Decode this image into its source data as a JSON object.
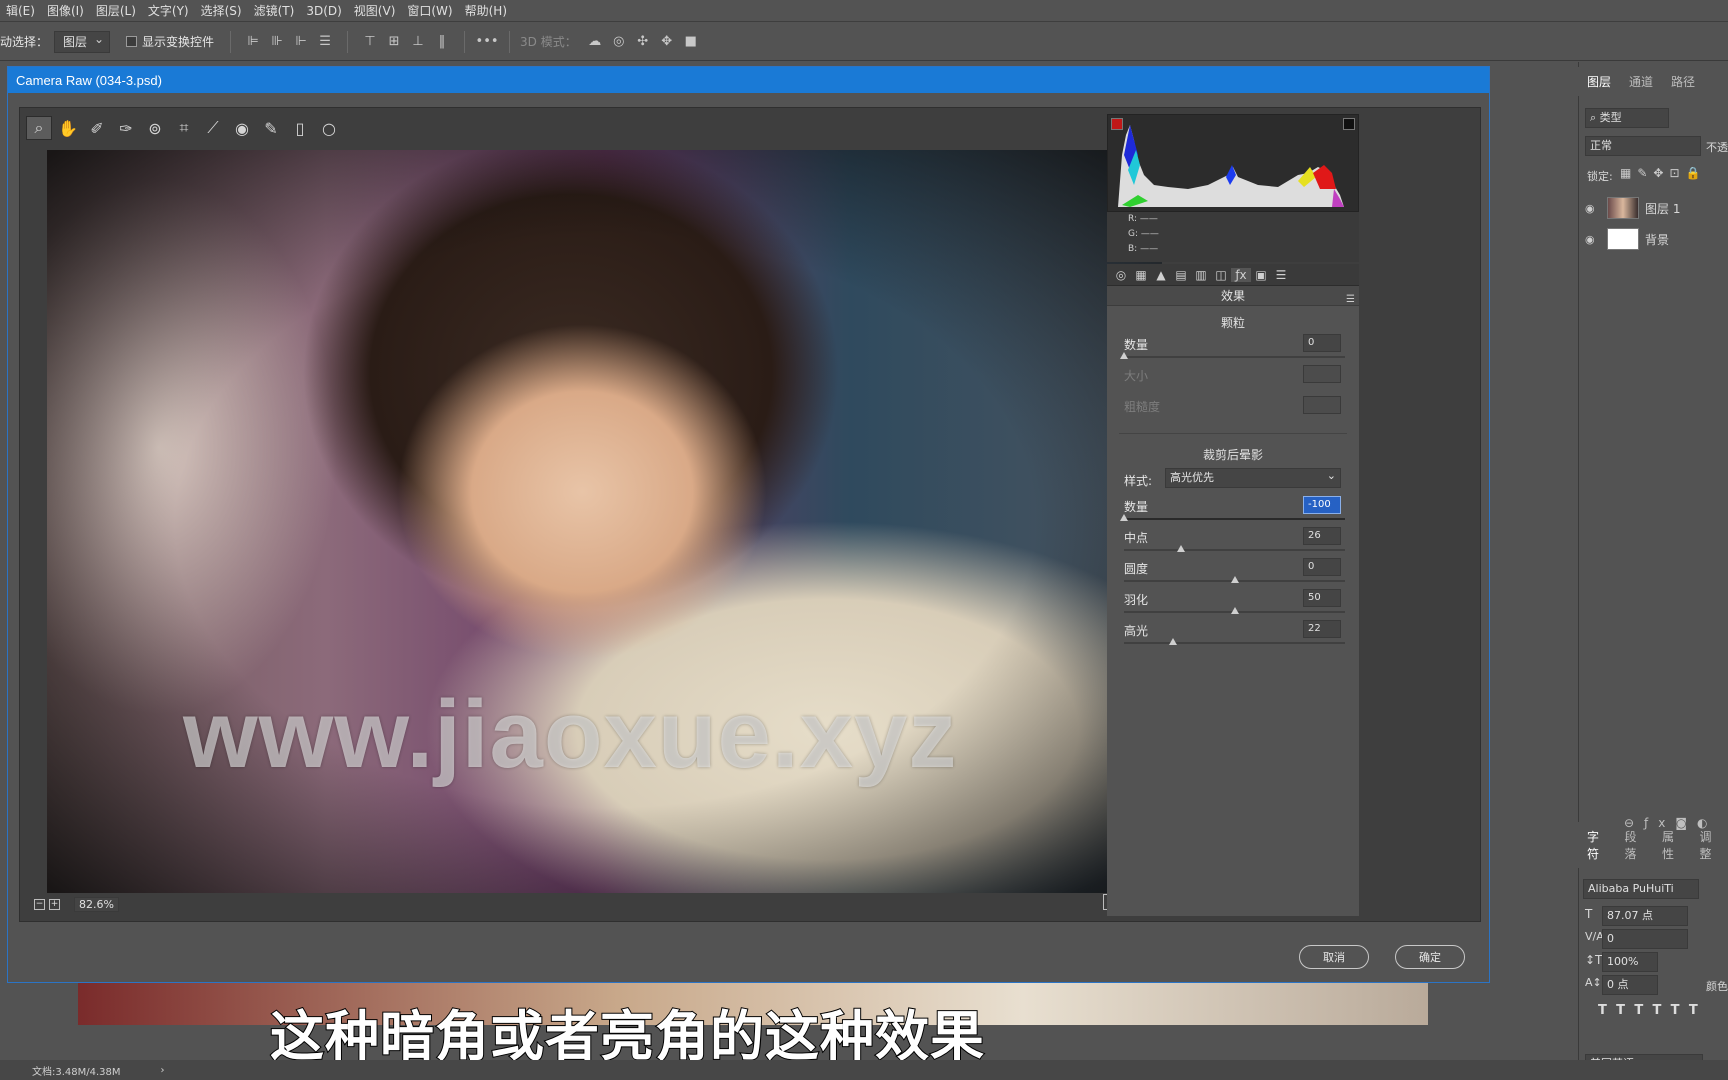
{
  "menubar": [
    "辑(E)",
    "图像(I)",
    "图层(L)",
    "文字(Y)",
    "选择(S)",
    "滤镜(T)",
    "3D(D)",
    "视图(V)",
    "窗口(W)",
    "帮助(H)"
  ],
  "options": {
    "auto_select_label": "动选择：",
    "auto_select_value": "图层",
    "transform_label": "显示变换控件",
    "mode3d_label": "3D 模式："
  },
  "dialog": {
    "title": "Camera Raw (034-3.psd)",
    "watermark": "www.jiaoxue.xyz",
    "zoom": "82.6%",
    "rgb": [
      "R:  ——",
      "G:  ——",
      "B:  ——"
    ],
    "panel_title": "效果",
    "grain": {
      "heading": "颗粒",
      "amount_label": "数量",
      "amount_value": "0",
      "amount_fraction": 0.0,
      "size_label": "大小",
      "roughness_label": "粗糙度"
    },
    "vignette": {
      "heading": "裁剪后晕影",
      "style_label": "样式:",
      "style_value": "高光优先",
      "amount_label": "数量",
      "amount_value": "-100",
      "amount_fraction": 0.0,
      "midpoint_label": "中点",
      "midpoint_value": "26",
      "midpoint_fraction": 0.26,
      "roundness_label": "圆度",
      "roundness_value": "0",
      "roundness_fraction": 0.5,
      "feather_label": "羽化",
      "feather_value": "50",
      "feather_fraction": 0.5,
      "highlights_label": "高光",
      "highlights_value": "22",
      "highlights_fraction": 0.22
    },
    "cancel": "取消",
    "ok": "确定"
  },
  "layers": {
    "tabs": [
      "图层",
      "通道",
      "路径"
    ],
    "filter": "类型",
    "blend": "正常",
    "opacity_label": "不透",
    "lock_label": "锁定:",
    "items": [
      "图层 1",
      "背景"
    ]
  },
  "character": {
    "tabs": [
      "字符",
      "段落",
      "属性",
      "调整"
    ],
    "font": "Alibaba PuHuiTi",
    "size": "87.07 点",
    "tracking": "0",
    "scale": "100%",
    "baseline": "0 点",
    "language": "美国英语",
    "color_label": "颜色"
  },
  "subtitle": "这种暗角或者亮角的这种效果",
  "status": {
    "doc": "文档:3.48M/4.38M",
    "arrow": "›"
  },
  "colors": {
    "title_blue": "#1a7ad6",
    "selected_field": "#2661c4"
  }
}
